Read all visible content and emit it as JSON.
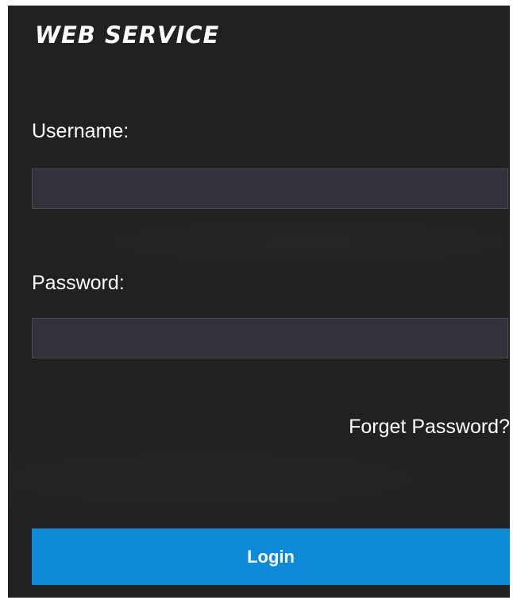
{
  "brand": {
    "title": "WEB SERVICE"
  },
  "form": {
    "username_label": "Username:",
    "username_value": "",
    "password_label": "Password:",
    "password_value": "",
    "forgot_label": "Forget Password?",
    "login_label": "Login"
  },
  "colors": {
    "panel_background": "#212121",
    "input_background": "#32323d",
    "login_button": "#0e8ad9",
    "text": "#ffffff"
  }
}
